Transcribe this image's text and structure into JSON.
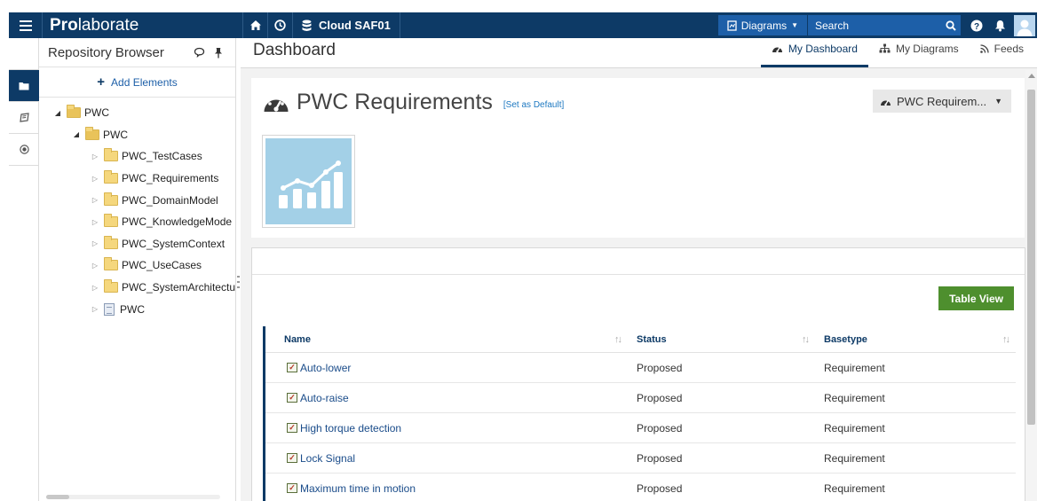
{
  "app": {
    "logo_bold": "Pro",
    "logo_rest": "laborate",
    "repository": "Cloud SAF01",
    "search_scope": "Diagrams",
    "search_placeholder": "Search"
  },
  "icons": {
    "menu": "hamburger-icon",
    "home": "home-icon",
    "history": "clock-icon",
    "repository": "database-icon",
    "diagram": "diagram-icon",
    "search": "search-icon",
    "help": "help-icon",
    "notifications": "bell-icon",
    "user": "avatar"
  },
  "colors": {
    "topbar": "#0d3a66",
    "accent": "#1d5fa8",
    "table_view_button": "#4e8f2e",
    "thumbnail": "#a3d0e7"
  },
  "repo_browser": {
    "title": "Repository Browser",
    "add_elements": "Add Elements",
    "tree": [
      {
        "label": "PWC",
        "level": 0,
        "state": "open",
        "kind": "folder"
      },
      {
        "label": "PWC",
        "level": 1,
        "state": "open",
        "kind": "folder"
      },
      {
        "label": "PWC_TestCases",
        "level": 2,
        "state": "closed",
        "kind": "folder"
      },
      {
        "label": "PWC_Requirements",
        "level": 2,
        "state": "closed",
        "kind": "folder"
      },
      {
        "label": "PWC_DomainModel",
        "level": 2,
        "state": "closed",
        "kind": "folder"
      },
      {
        "label": "PWC_KnowledgeMode",
        "level": 2,
        "state": "closed",
        "kind": "folder"
      },
      {
        "label": "PWC_SystemContext",
        "level": 2,
        "state": "closed",
        "kind": "folder"
      },
      {
        "label": "PWC_UseCases",
        "level": 2,
        "state": "closed",
        "kind": "folder"
      },
      {
        "label": "PWC_SystemArchitectu",
        "level": 2,
        "state": "closed",
        "kind": "folder"
      },
      {
        "label": "PWC",
        "level": 2,
        "state": "closed",
        "kind": "package"
      }
    ]
  },
  "main": {
    "title": "Dashboard",
    "tabs": [
      {
        "label": "My Dashboard",
        "icon": "dashboard-icon",
        "active": true
      },
      {
        "label": "My Diagrams",
        "icon": "sitemap-icon",
        "active": false
      },
      {
        "label": "Feeds",
        "icon": "rss-icon",
        "active": false
      }
    ],
    "dashboard": {
      "title": "PWC Requirements",
      "set_default": "[Set as Default]",
      "selector": "PWC Requirem..."
    },
    "list": {
      "table_view_button": "Table View",
      "columns": [
        "Name",
        "Status",
        "Basetype"
      ],
      "rows": [
        {
          "name": "Auto-lower",
          "status": "Proposed",
          "basetype": "Requirement"
        },
        {
          "name": "Auto-raise",
          "status": "Proposed",
          "basetype": "Requirement"
        },
        {
          "name": "High torque detection",
          "status": "Proposed",
          "basetype": "Requirement"
        },
        {
          "name": "Lock Signal",
          "status": "Proposed",
          "basetype": "Requirement"
        },
        {
          "name": "Maximum time in motion",
          "status": "Proposed",
          "basetype": "Requirement"
        }
      ]
    }
  }
}
